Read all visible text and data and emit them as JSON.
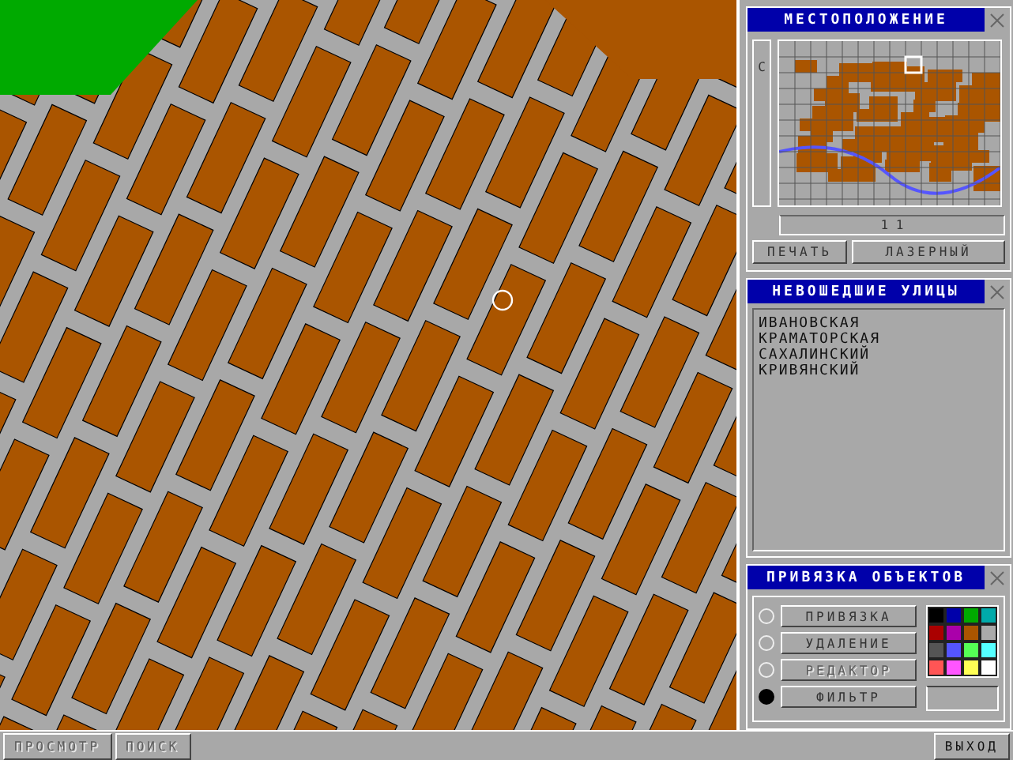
{
  "location_panel": {
    "title": "МЕСТОПОЛОЖЕНИЕ",
    "side_label": "С",
    "sheet_number": "1 1",
    "buttons": [
      {
        "label": "ПЕЧАТЬ",
        "disabled": false
      },
      {
        "label": "ЛАЗЕРНЫЙ",
        "disabled": false
      }
    ]
  },
  "streets_panel": {
    "title": "НЕВОШЕДШИЕ УЛИЦЫ",
    "items": [
      "ИВАНОВСКАЯ",
      "КРАМАТОРСКАЯ",
      "САХАЛИНСКИЙ",
      "КРИВЯНСКИЙ"
    ]
  },
  "binding_panel": {
    "title": "ПРИВЯЗКА ОБЪЕКТОВ",
    "modes": [
      {
        "label": "ПРИВЯЗКА",
        "selected": false,
        "disabled": false
      },
      {
        "label": "УДАЛЕНИЕ",
        "selected": false,
        "disabled": false
      },
      {
        "label": "РЕДАКТОР",
        "selected": false,
        "disabled": true
      },
      {
        "label": "ФИЛЬТР",
        "selected": true,
        "disabled": false
      }
    ],
    "palette": [
      {
        "color": "#000000"
      },
      {
        "color": "#0000aa"
      },
      {
        "color": "#00aa00"
      },
      {
        "color": "#00aaaa"
      },
      {
        "color": "#aa0000"
      },
      {
        "color": "#aa00aa"
      },
      {
        "color": "#aa5500"
      },
      {
        "color": "#aaaaaa"
      },
      {
        "color": "#555555"
      },
      {
        "color": "#5555ff"
      },
      {
        "color": "#55ff55"
      },
      {
        "color": "#55ffff"
      },
      {
        "color": "#ff5555"
      },
      {
        "color": "#ff55ff"
      },
      {
        "color": "#ffff55"
      },
      {
        "color": "#ffffff"
      }
    ]
  },
  "bottom_bar": {
    "buttons": [
      {
        "label": "ПРОСМОТР",
        "disabled": true
      },
      {
        "label": "ПОИСК",
        "disabled": true
      }
    ],
    "exit_button": "ВЫХОД"
  }
}
